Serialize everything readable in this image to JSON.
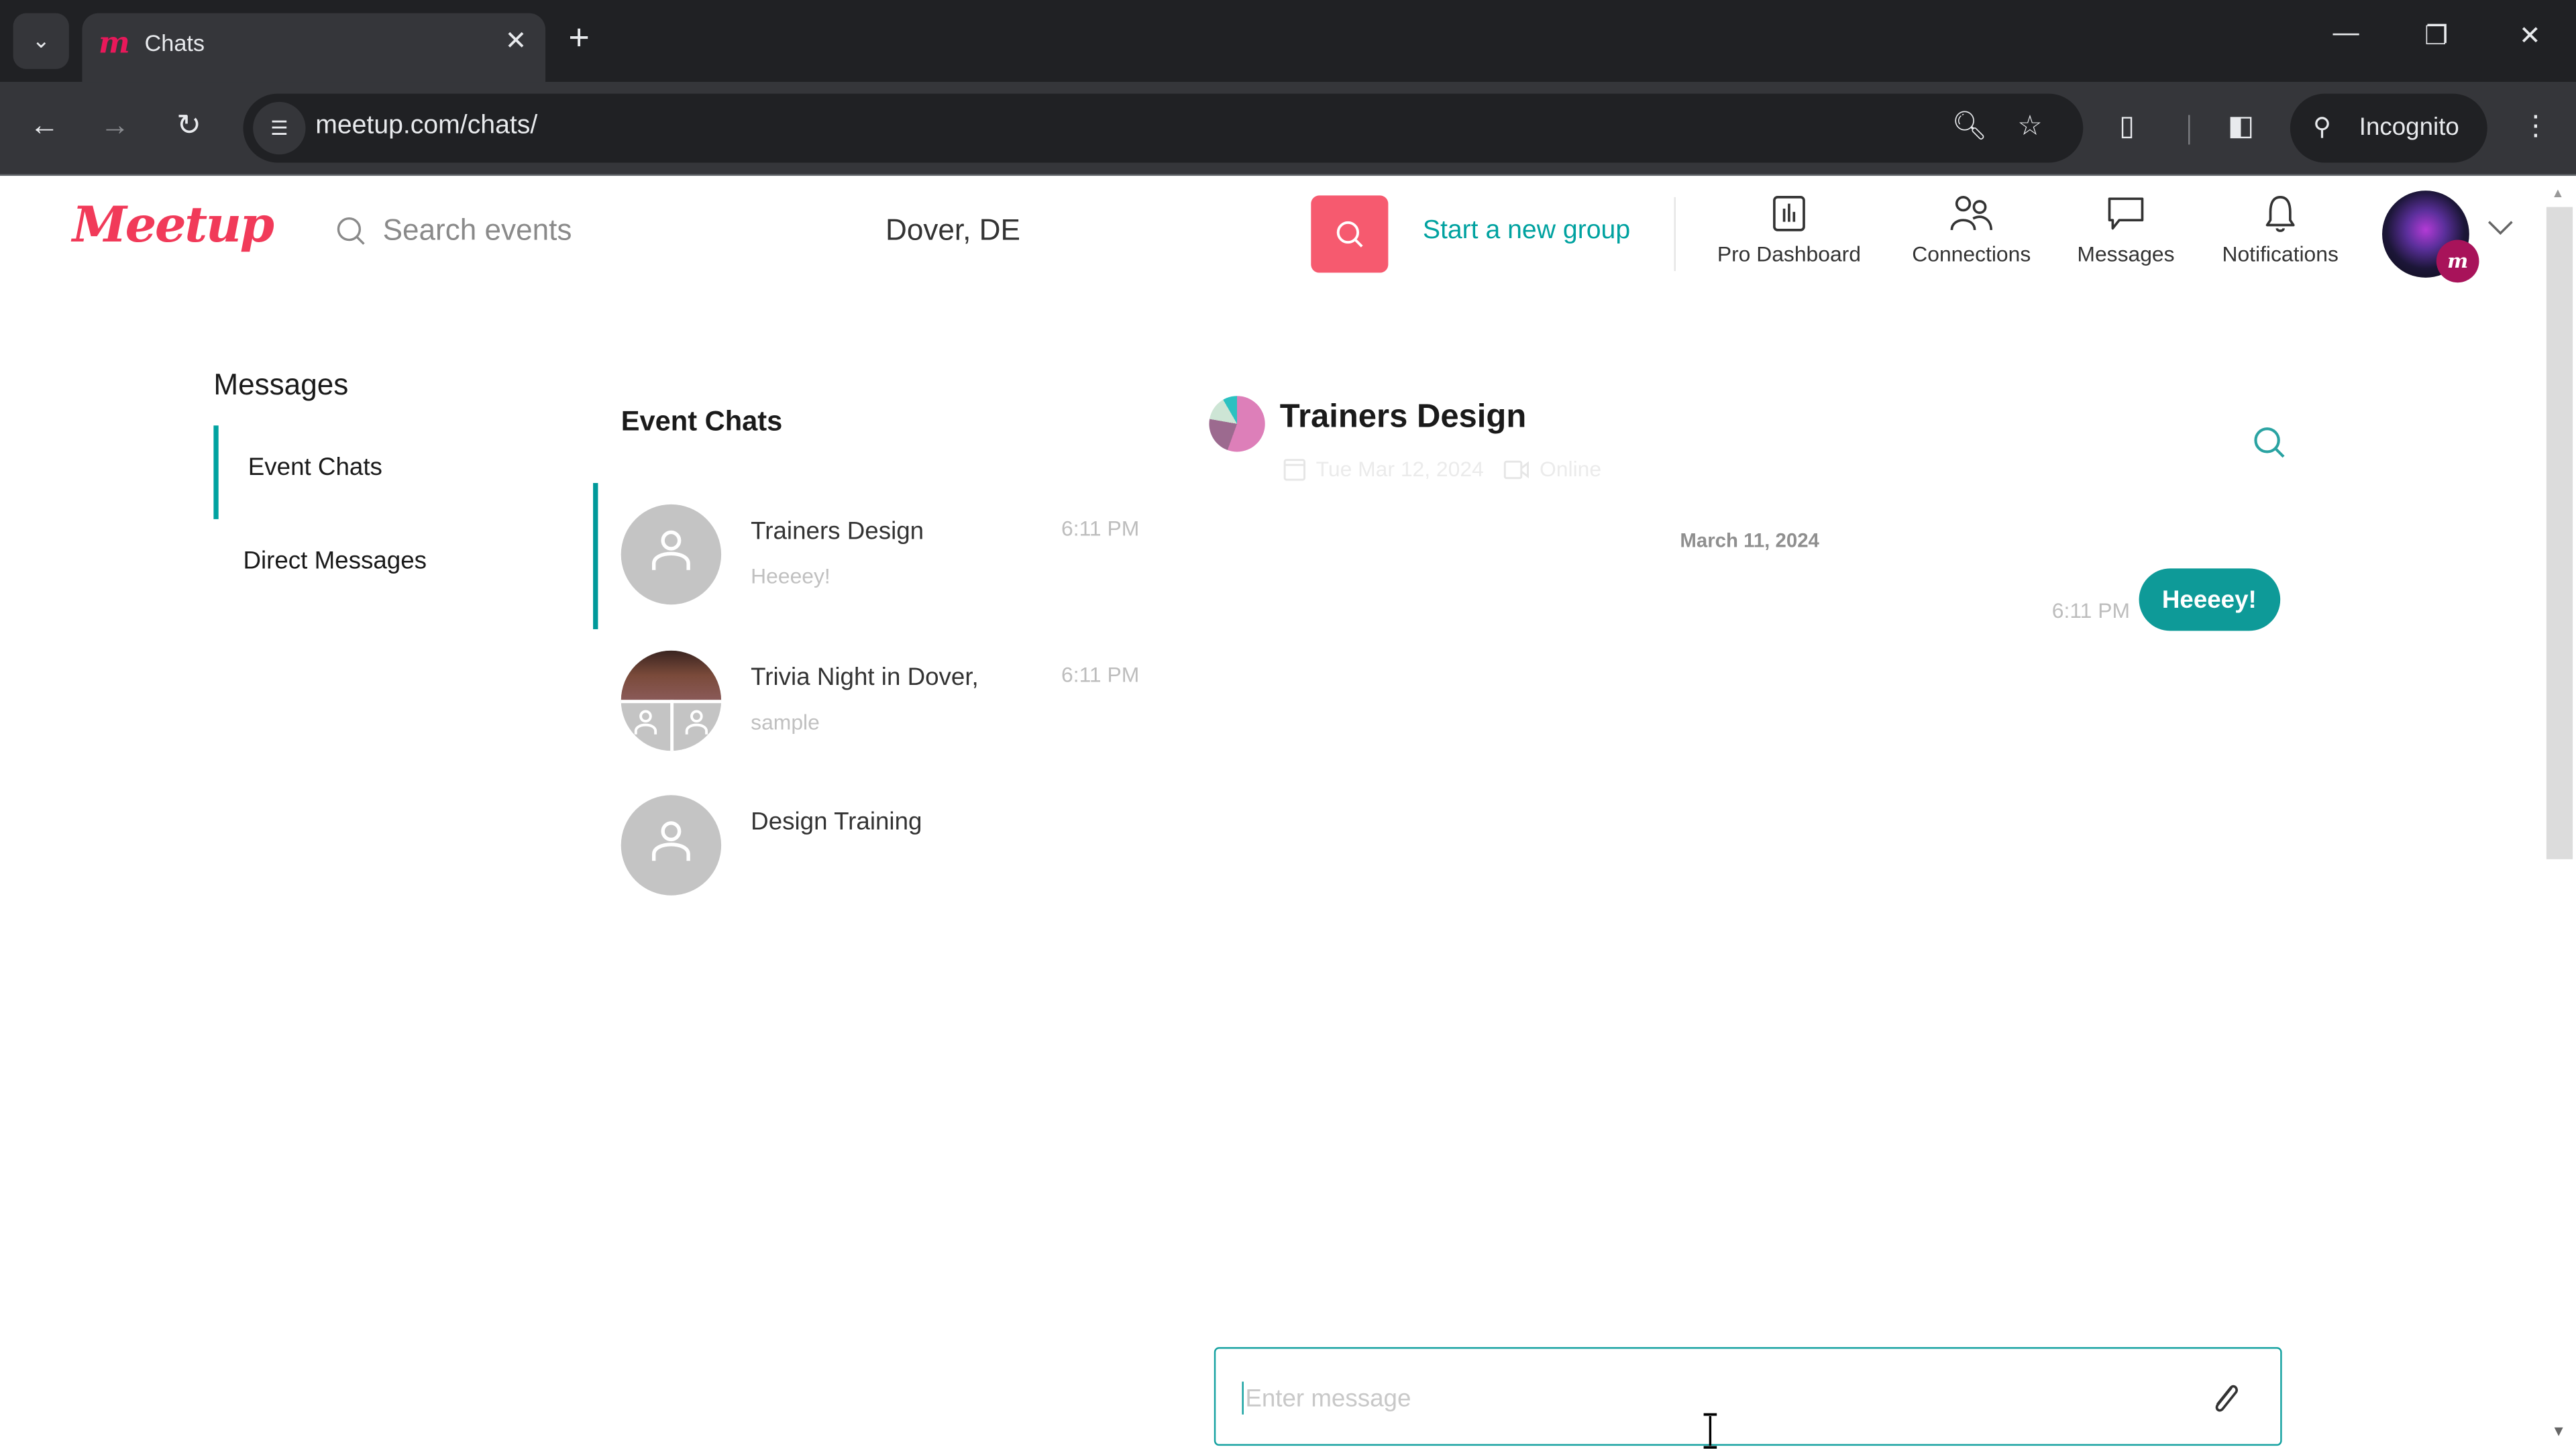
{
  "browser": {
    "tab_title": "Chats",
    "tab_favicon": "m",
    "url": "meetup.com/chats/",
    "incognito_label": "Incognito",
    "icons": [
      "tab-search-icon",
      "close-icon",
      "new-tab-icon",
      "minimize-icon",
      "restore-icon",
      "window-close-icon",
      "back-icon",
      "forward-icon",
      "reload-icon",
      "site-info-icon",
      "zoom-icon",
      "bookmark-star-icon",
      "extensions-icon",
      "side-panel-icon",
      "incognito-icon",
      "menu-icon"
    ]
  },
  "header": {
    "logo": "Meetup",
    "search_placeholder": "Search events",
    "location": "Dover, DE",
    "start_group": "Start a new group",
    "nav": [
      {
        "label": "Pro Dashboard",
        "icon": "chart-icon"
      },
      {
        "label": "Connections",
        "icon": "people-icon"
      },
      {
        "label": "Messages",
        "icon": "chat-bubble-icon"
      },
      {
        "label": "Notifications",
        "icon": "bell-icon"
      }
    ],
    "avatar_badge": "m"
  },
  "sidebar": {
    "title": "Messages",
    "items": [
      {
        "label": "Event Chats",
        "active": true
      },
      {
        "label": "Direct Messages",
        "active": false
      }
    ]
  },
  "chat_list": {
    "title": "Event Chats",
    "items": [
      {
        "name": "Trainers Design",
        "preview": "Heeeey!",
        "time": "6:11 PM",
        "active": true
      },
      {
        "name": "Trivia Night in Dover,",
        "preview": "sample",
        "time": "6:11 PM",
        "active": false
      },
      {
        "name": "Design Training",
        "preview": "",
        "time": "",
        "active": false
      }
    ]
  },
  "conversation": {
    "title": "Trainers Design",
    "event_date": "Tue Mar 12, 2024",
    "event_location": "Online",
    "date_separator": "March 11, 2024",
    "messages": [
      {
        "text": "Heeeey!",
        "time": "6:11 PM",
        "outgoing": true
      }
    ],
    "composer_placeholder": "Enter message"
  },
  "colors": {
    "brand": "#f13a59",
    "search_button": "#f65a6f",
    "accent_teal": "#00a2a0",
    "bubble": "#0e9a98"
  }
}
